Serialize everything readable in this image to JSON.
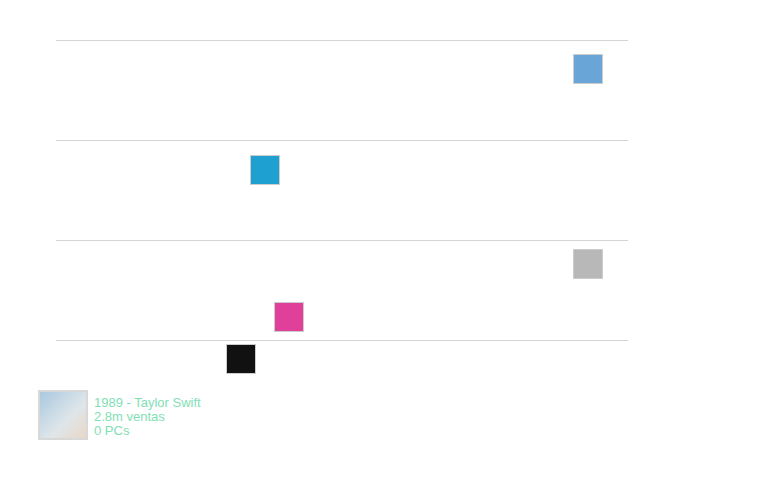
{
  "chart": {
    "points": [
      {
        "x": 93.0,
        "y": 2.72,
        "color": "#6aa5d8"
      },
      {
        "x": 36.5,
        "y": 1.71,
        "color": "#1ea0d0"
      },
      {
        "x": 93.0,
        "y": 0.77,
        "color": "#b8b8b8"
      },
      {
        "x": 40.7,
        "y": 0.24,
        "color": "#e0409a"
      },
      {
        "x": 32.3,
        "y": -0.18,
        "color": "#111111"
      }
    ]
  },
  "legend": {
    "title": "1989 - Taylor Swift",
    "sales": "2.8m ventas",
    "pcs": "0 PCs"
  }
}
